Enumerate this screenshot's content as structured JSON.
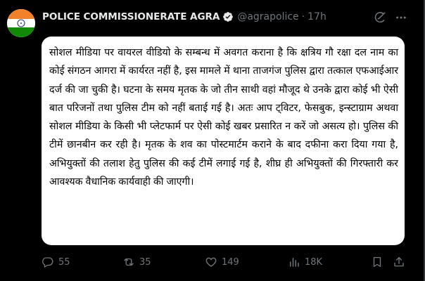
{
  "post": {
    "author_name": "POLICE COMMISSIONERATE AGRA",
    "handle": "@agrapolice",
    "separator": "·",
    "time": "17h",
    "body": "सोशल मीडिया पर वायरल वीडियो के सम्बन्ध में अवगत कराना है कि क्षत्रिय गौ रक्षा दल नाम का कोई संगठन आगरा में कार्यरत नहीं है, इस मामले में थाना ताजगंज पुलिस द्वारा तत्काल एफआईआर दर्ज की जा चुकी है। घटना के समय मृतक के जो तीन साथी वहां मौजूद थे उनके द्वारा कोई भी ऐसी बात परिजनों तथा पुलिस टीम को नहीं बताई गई है। अतः आप ट्विटर, फेसबुक, इन्स्टाग्राम अथवा सोशल मीडिया के किसी भी प्लेटफार्म पर ऐसी कोई खबर प्रसारित न करें जो असत्य हो। पुलिस की टीमें छानबीन कर रही है। मृतक के शव का पोस्टमार्टम कराने के बाद दफीना करा दिया गया है, अभियुक्तों की तलाश हेतु पुलिस की कई टीमें लगाई गई है, शीघ्र ही अभियुक्तों की गिरफ्तारी कर आवश्यक वैधानिक कार्यवाही की जाएगी।"
  },
  "stats": {
    "replies": "55",
    "reposts": "35",
    "likes": "149",
    "views": "18K"
  },
  "icons": {
    "verified": "verified-badge-icon",
    "grok": "grok-icon",
    "more": "more-options-icon",
    "reply": "reply-icon",
    "repost": "repost-icon",
    "like": "like-icon",
    "views": "views-icon",
    "bookmark": "bookmark-icon",
    "share": "share-icon"
  },
  "colors": {
    "background": "#000000",
    "text": "#e7e9ea",
    "muted": "#71767b",
    "verified": "#e7e9ea",
    "card": "#ffffff"
  }
}
